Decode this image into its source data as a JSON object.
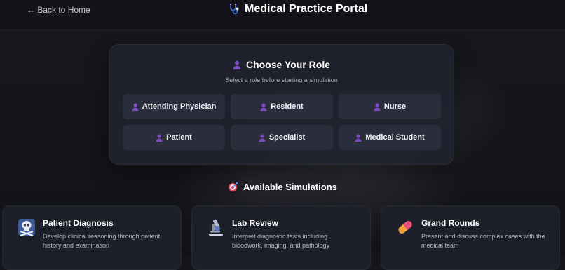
{
  "header": {
    "back_label": "← Back to Home",
    "title": "Medical Practice Portal",
    "title_icon": "stethoscope-icon"
  },
  "roles": {
    "title": "Choose Your Role",
    "subtitle": "Select a role before starting a simulation",
    "icon": "person-icon",
    "items": [
      {
        "label": "Attending Physician"
      },
      {
        "label": "Resident"
      },
      {
        "label": "Nurse"
      },
      {
        "label": "Patient"
      },
      {
        "label": "Specialist"
      },
      {
        "label": "Medical Student"
      }
    ]
  },
  "simulations": {
    "title": "Available Simulations",
    "icon": "target-icon",
    "items": [
      {
        "title": "Patient Diagnosis",
        "description": "Develop clinical reasoning through patient history and examination",
        "icon": "diagnosis-icon"
      },
      {
        "title": "Lab Review",
        "description": "Interpret diagnostic tests including bloodwork, imaging, and pathology",
        "icon": "microscope-icon"
      },
      {
        "title": "Grand Rounds",
        "description": "Present and discuss complex cases with the medical team",
        "icon": "pill-icon"
      }
    ]
  },
  "colors": {
    "background": "#15161b",
    "card": "#20222c",
    "role_button": "#2a2d3b",
    "accent_purple": "#7b4bc4"
  }
}
